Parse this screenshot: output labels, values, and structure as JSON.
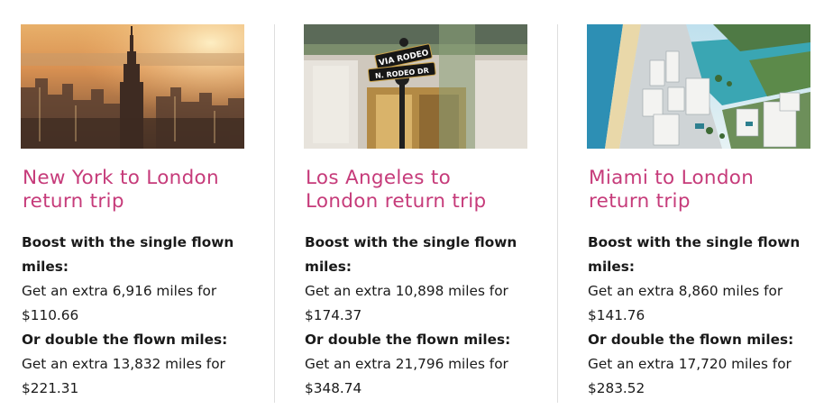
{
  "offers": [
    {
      "title_line1": "New York to London",
      "title_line2": "return trip",
      "single_heading_line1": "Boost with the single flown",
      "single_heading_line2": "miles:",
      "single_text_line1": "Get an extra 6,916 miles for",
      "single_price": "$110.66",
      "double_heading": "Or double the flown miles:",
      "double_text_line1": "Get an extra 13,832 miles for",
      "double_price": "$221.31"
    },
    {
      "title_line1": "Los Angeles to",
      "title_line2": "London return trip",
      "single_heading_line1": "Boost with the single flown",
      "single_heading_line2": "miles:",
      "single_text_line1": "Get an extra 10,898 miles for",
      "single_price": "$174.37",
      "double_heading": "Or double the flown miles:",
      "double_text_line1": "Get an extra 21,796 miles for",
      "double_price": "$348.74",
      "sign_top": "VIA RODEO",
      "sign_bottom": "N. RODEO DR"
    },
    {
      "title_line1": "Miami to London",
      "title_line2": "return trip",
      "single_heading_line1": "Boost with the single flown",
      "single_heading_line2": "miles:",
      "single_text_line1": "Get an extra 8,860 miles for",
      "single_price": "$141.76",
      "double_heading": "Or double the flown miles:",
      "double_text_line1": "Get an extra 17,720 miles for",
      "double_price": "$283.52"
    }
  ],
  "colors": {
    "title": "#c63b7a",
    "text": "#1a1a1a",
    "divider": "#dedede"
  }
}
